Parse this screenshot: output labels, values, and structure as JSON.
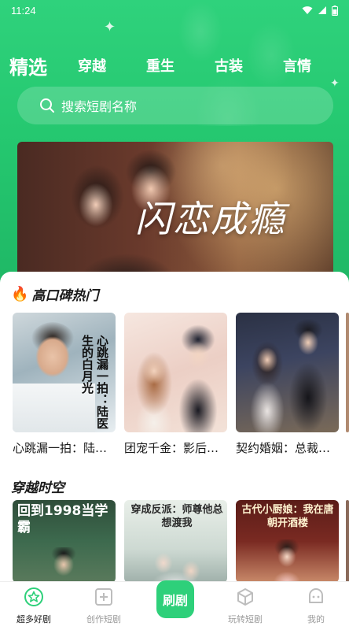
{
  "status_bar": {
    "time": "11:24"
  },
  "tabs": [
    {
      "label": "精选",
      "active": true
    },
    {
      "label": "穿越",
      "active": false
    },
    {
      "label": "重生",
      "active": false
    },
    {
      "label": "古装",
      "active": false
    },
    {
      "label": "言情",
      "active": false
    }
  ],
  "search": {
    "placeholder": "搜索短剧名称"
  },
  "banner": {
    "title": "闪恋成瘾"
  },
  "sections": [
    {
      "title": "高口碑热门",
      "cards": [
        {
          "title": "心跳漏一拍：陆医生的白月光",
          "poster_text": "心跳漏一拍：陆医生的白月光"
        },
        {
          "title": "团宠千金：影后归来",
          "poster_text": ""
        },
        {
          "title": "契约婚姻：总裁的替身新娘",
          "poster_text": ""
        }
      ]
    },
    {
      "title": "穿越时空",
      "cards": [
        {
          "poster_text": "回到1998当学霸"
        },
        {
          "poster_text": "穿成反派：师尊他总想渡我"
        },
        {
          "poster_text": "古代小厨娘：我在唐朝开酒楼"
        }
      ]
    }
  ],
  "bottom_nav": {
    "items": [
      {
        "label": "超多好剧",
        "active": true
      },
      {
        "label": "创作短剧",
        "active": false
      },
      {
        "label": "玩转短剧",
        "active": false
      },
      {
        "label": "我的",
        "active": false
      }
    ],
    "center_label": "刷剧"
  },
  "colors": {
    "accent": "#2ed07a",
    "hero": "#25c870"
  }
}
